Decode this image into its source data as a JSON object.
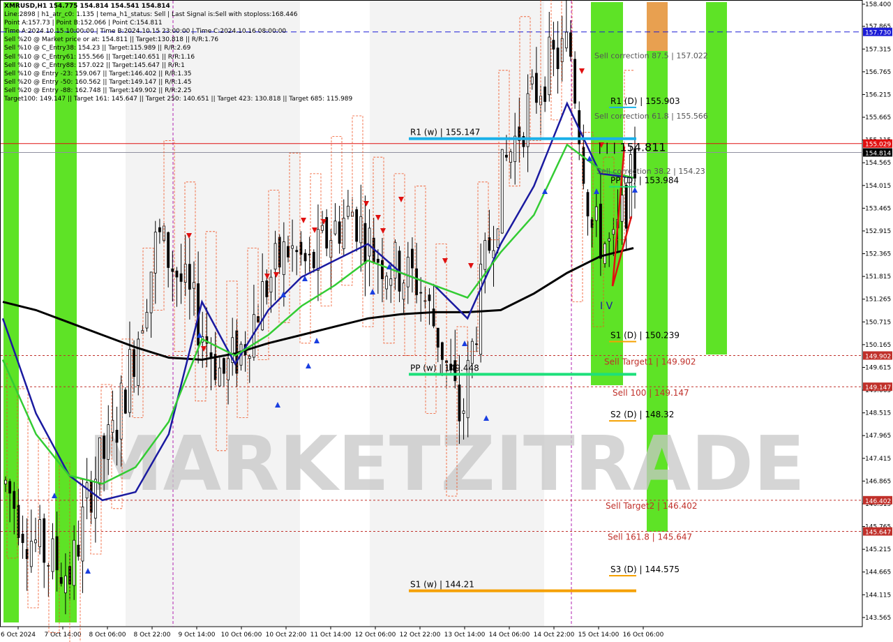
{
  "header": {
    "lines": [
      "XMRUSD,H1  154.775 154.814 154.541 154.814",
      "Line:2898  |  h1_atr_c0: 1.135  |  tema_h1_status: Sell  |  Last Signal is:Sell with stoploss:168.446",
      "Point A:157.73  |  Point B:152.066  |  Point C:154.811",
      "Time A:2024.10.15 10:00:00  |  Time B:2024.10.15 23:00:00  |  Time C:2024.10.16 08:00:00",
      "Sell %20 @ Market price or at: 154.811  ||  Target:130.818  ||  R/R:1.76",
      "Sell %10 @ C_Entry38: 154.23  ||  Target:115.989  ||  R/R:2.69",
      "Sell %10 @ C_Entry61: 155.566  ||  Target:140.651  ||  R/R:1.16",
      "Sell %10 @ C_Entry88: 157.022  ||  Target:145.647  ||  R/R:1",
      "Sell %10 @ Entry -23: 159.067  ||  Target:146.402  ||  R/R:1.35",
      "Sell %20 @ Entry -50: 160.562  ||  Target:149.147  ||  R/R:1.45",
      "Sell %20 @ Entry -88: 162.748  ||  Target:149.902  ||  R/R:2.25",
      "Target100: 149.147  ||  Target 161: 145.647  ||  Target 250: 140.651  ||  Target 423: 130.818  ||  Target 685: 115.989"
    ]
  },
  "chart_data": {
    "type": "candlestick",
    "symbol": "XMRUSD,H1",
    "ylim": [
      143.445,
      158.4
    ],
    "y_ticks": [
      158.4,
      157.865,
      157.315,
      156.765,
      156.215,
      155.665,
      155.115,
      154.565,
      154.015,
      153.465,
      152.915,
      152.365,
      151.815,
      151.265,
      150.715,
      150.165,
      149.615,
      149.065,
      148.515,
      147.965,
      147.415,
      146.865,
      146.315,
      145.765,
      145.215,
      144.665,
      144.115,
      143.565
    ],
    "x_labels": [
      "6 Oct 2024",
      "7 Oct 14:00",
      "8 Oct 06:00",
      "8 Oct 22:00",
      "9 Oct 14:00",
      "10 Oct 06:00",
      "10 Oct 22:00",
      "11 Oct 14:00",
      "12 Oct 06:00",
      "12 Oct 22:00",
      "13 Oct 14:00",
      "14 Oct 06:00",
      "14 Oct 22:00",
      "15 Oct 14:00",
      "16 Oct 06:00"
    ],
    "price_boxes": [
      {
        "label": "157.730",
        "value": 157.73,
        "color": "#1c1cd6"
      },
      {
        "label": "155.029",
        "value": 155.029,
        "color": "#e01010"
      },
      {
        "label": "154.814",
        "value": 154.814,
        "color": "#000000"
      },
      {
        "label": "149.902",
        "value": 149.902,
        "color": "#c0302a"
      },
      {
        "label": "149.147",
        "value": 149.147,
        "color": "#c0302a"
      },
      {
        "label": "146.402",
        "value": 146.402,
        "color": "#c0302a"
      },
      {
        "label": "145.647",
        "value": 145.647,
        "color": "#c0302a"
      }
    ],
    "pivot_levels": [
      {
        "label": "R1 (w) | 155.147",
        "value": 155.147,
        "color": "#1ab0e8"
      },
      {
        "label": "PP (w) | 149.448",
        "value": 149.448,
        "color": "#1de07a"
      },
      {
        "label": "S1 (w) | 144.21",
        "value": 144.21,
        "color": "#f5a000"
      },
      {
        "label": "R1 (D) | 155.903",
        "value": 155.903,
        "color": "#1ab0e8"
      },
      {
        "label": "PP (D) | 153.984",
        "value": 153.984,
        "color": "#1de07a"
      },
      {
        "label": "S1 (D) | 150.239",
        "value": 150.239,
        "color": "#f5a000"
      },
      {
        "label": "S2 (D) | 148.32",
        "value": 148.32,
        "color": "#f5a000"
      },
      {
        "label": "S3 (D) | 144.575",
        "value": 144.575,
        "color": "#f5a000"
      }
    ],
    "target_labels": [
      {
        "label": "Sell correction 87.5 | 157.022",
        "value": 157.022
      },
      {
        "label": "| | | 154.811",
        "value": 154.811
      },
      {
        "label": "Sell correction 61.8 | 155.566",
        "value": 155.566
      },
      {
        "label": "Sell correction 38.2 | 154.23",
        "value": 154.23
      },
      {
        "label": "Sell Target1 | 149.902",
        "value": 149.902
      },
      {
        "label": "Sell 100 | 149.147",
        "value": 149.147
      },
      {
        "label": "Sell Target2 | 146.402",
        "value": 146.402
      },
      {
        "label": "Sell 161.8 | 145.647",
        "value": 145.647
      }
    ],
    "wave_label": "I V",
    "watermark": "MARKETZITRADE",
    "ma_series": [
      {
        "color": "#000000",
        "values": [
          151.2,
          151.0,
          150.7,
          150.4,
          150.1,
          149.85,
          149.8,
          149.95,
          150.2,
          150.4,
          150.6,
          150.8,
          150.9,
          150.95,
          150.95,
          151.0,
          151.4,
          151.9,
          152.3,
          152.5
        ]
      },
      {
        "color": "#1a1aa0",
        "values": [
          150.8,
          148.5,
          147.0,
          146.4,
          146.6,
          148.0,
          151.2,
          149.7,
          151.0,
          151.8,
          152.2,
          152.6,
          151.9,
          151.6,
          150.8,
          152.6,
          154.0,
          156.0,
          154.3,
          154.2
        ]
      },
      {
        "color": "#33cc33",
        "values": [
          149.8,
          148.0,
          147.0,
          146.8,
          147.2,
          148.3,
          150.3,
          149.9,
          150.4,
          151.1,
          151.6,
          152.2,
          151.9,
          151.6,
          151.3,
          152.4,
          153.3,
          155.0,
          154.4,
          154.2
        ]
      }
    ]
  }
}
